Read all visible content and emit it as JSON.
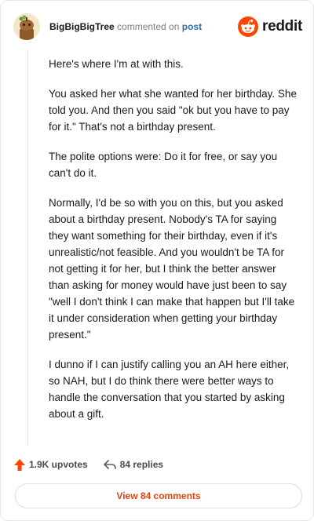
{
  "header": {
    "username": "BigBigBigTree",
    "action_text": "commented on",
    "post_link": "post",
    "brand": "reddit"
  },
  "comment": {
    "paragraphs": [
      "Here's where I'm at with this.",
      "You asked her what she wanted for her birthday. She told you. And then you said \"ok but you have to pay for it.\" That's not a birthday present.",
      "The polite options were: Do it for free, or say you can't do it.",
      "Normally, I'd be so with you on this, but you asked about a birthday present. Nobody's TA for saying they want something for their birthday, even if it's unrealistic/not feasible. And you wouldn't be TA for not getting it for her, but I think the better answer than asking for money would have just been to say \"well I don't think I can make that happen but I'll take it under consideration when getting your birthday present.\"",
      "I dunno if I can justify calling you an AH here either, so NAH, but I do think there were better ways to handle the conversation that you started by asking about a gift."
    ]
  },
  "footer": {
    "upvotes": "1.9K upvotes",
    "replies": "84 replies",
    "view_comments": "View 84 comments"
  },
  "colors": {
    "reddit_orange": "#ff4500",
    "upvote_orange": "#ff4500",
    "link_blue": "#2e6da4",
    "button_text": "#e0430e"
  },
  "icons": {
    "avatar": "snoo-avatar-icon",
    "brand": "reddit-logo-icon",
    "upvote": "upvote-arrow-icon",
    "reply": "reply-arrow-icon"
  }
}
